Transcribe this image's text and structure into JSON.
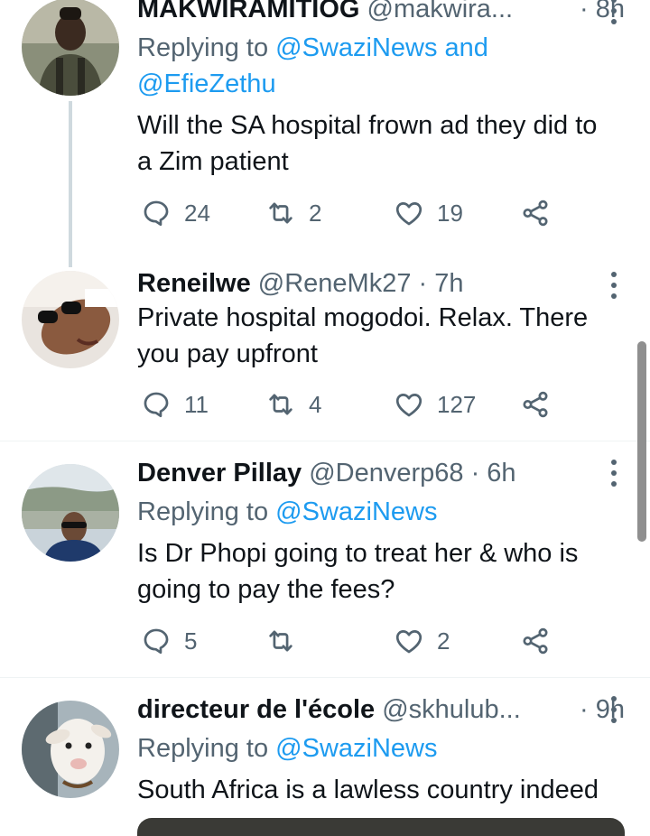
{
  "tweets": [
    {
      "name": "MAKWIRAMITIOG",
      "handle": "@makwira...",
      "time": "· 8h",
      "replying_prefix": "Replying to ",
      "replying_mentions": "@SwaziNews and",
      "replying_line2": "@EfieZethu",
      "text_line1": "Will the SA hospital frown ad they did to",
      "text_line2": "a Zim patient",
      "replies": "24",
      "retweets": "2",
      "likes": "19"
    },
    {
      "name": "Reneilwe",
      "handle": "@ReneMk27",
      "time": "· 7h",
      "text_line1": "Private hospital mogodoi. Relax. There",
      "text_line2": "you pay upfront",
      "replies": "11",
      "retweets": "4",
      "likes": "127"
    },
    {
      "name": "Denver Pillay",
      "handle": "@Denverp68",
      "time": "· 6h",
      "replying_prefix": "Replying to ",
      "replying_mentions": "@SwaziNews",
      "text_line1": "Is Dr Phopi going to treat her & who is",
      "text_line2": "going to pay the fees?",
      "replies": "5",
      "retweets": "",
      "likes": "2"
    },
    {
      "name": "directeur de l'école",
      "handle": "@skhulub...",
      "time": "· 9h",
      "replying_prefix": "Replying to ",
      "replying_mentions": "@SwaziNews",
      "text_line1": "South Africa is a lawless country indeed"
    }
  ],
  "icons": [
    "reply-icon",
    "retweet-icon",
    "like-icon",
    "share-icon",
    "more-icon"
  ],
  "colors": {
    "link": "#1d9bf0",
    "secondary": "#536471",
    "divider": "#eff3f4",
    "thread": "#cfd9de"
  }
}
